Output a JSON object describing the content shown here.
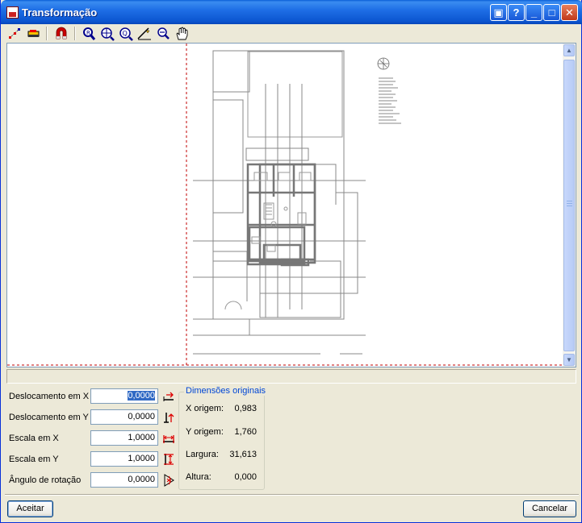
{
  "window": {
    "title": "Transformação",
    "icon": "app-drawing-icon",
    "controls": [
      "help-book-icon",
      "question-icon",
      "minimize-icon",
      "maximize-icon",
      "close-icon"
    ],
    "control_glyphs": {
      "help": "▣",
      "question": "?",
      "minimize": "_",
      "maximize": "□",
      "close": "✕"
    }
  },
  "toolbar": {
    "tools": [
      "snap-points-icon",
      "eraser-icon",
      "magnet-icon",
      "zoom-realtime-icon",
      "zoom-window-icon",
      "zoom-extents-icon",
      "measure-icon",
      "zoom-previous-icon",
      "pan-hand-icon"
    ]
  },
  "plan_legend": {
    "lines": 15
  },
  "form": {
    "offset_x": {
      "label": "Deslocamento em X",
      "value": "0,0000"
    },
    "offset_y": {
      "label": "Deslocamento em Y",
      "value": "0,0000"
    },
    "scale_x": {
      "label": "Escala em X",
      "value": "1,0000"
    },
    "scale_y": {
      "label": "Escala em Y",
      "value": "1,0000"
    },
    "rotation": {
      "label": "Ângulo de rotação",
      "value": "0,0000"
    }
  },
  "original_dimensions": {
    "title": "Dimensões originais",
    "x_origin": {
      "label": "X origem:",
      "value": "0,983"
    },
    "y_origin": {
      "label": "Y origem:",
      "value": "1,760"
    },
    "width": {
      "label": "Largura:",
      "value": "31,613"
    },
    "height": {
      "label": "Altura:",
      "value": "0,000"
    }
  },
  "buttons": {
    "accept": "Aceitar",
    "cancel": "Cancelar"
  },
  "colors": {
    "title_bar": "#0b55d0",
    "selection": "#316ac5",
    "group_title": "#0046d5",
    "boundary_dash": "#c00000"
  }
}
